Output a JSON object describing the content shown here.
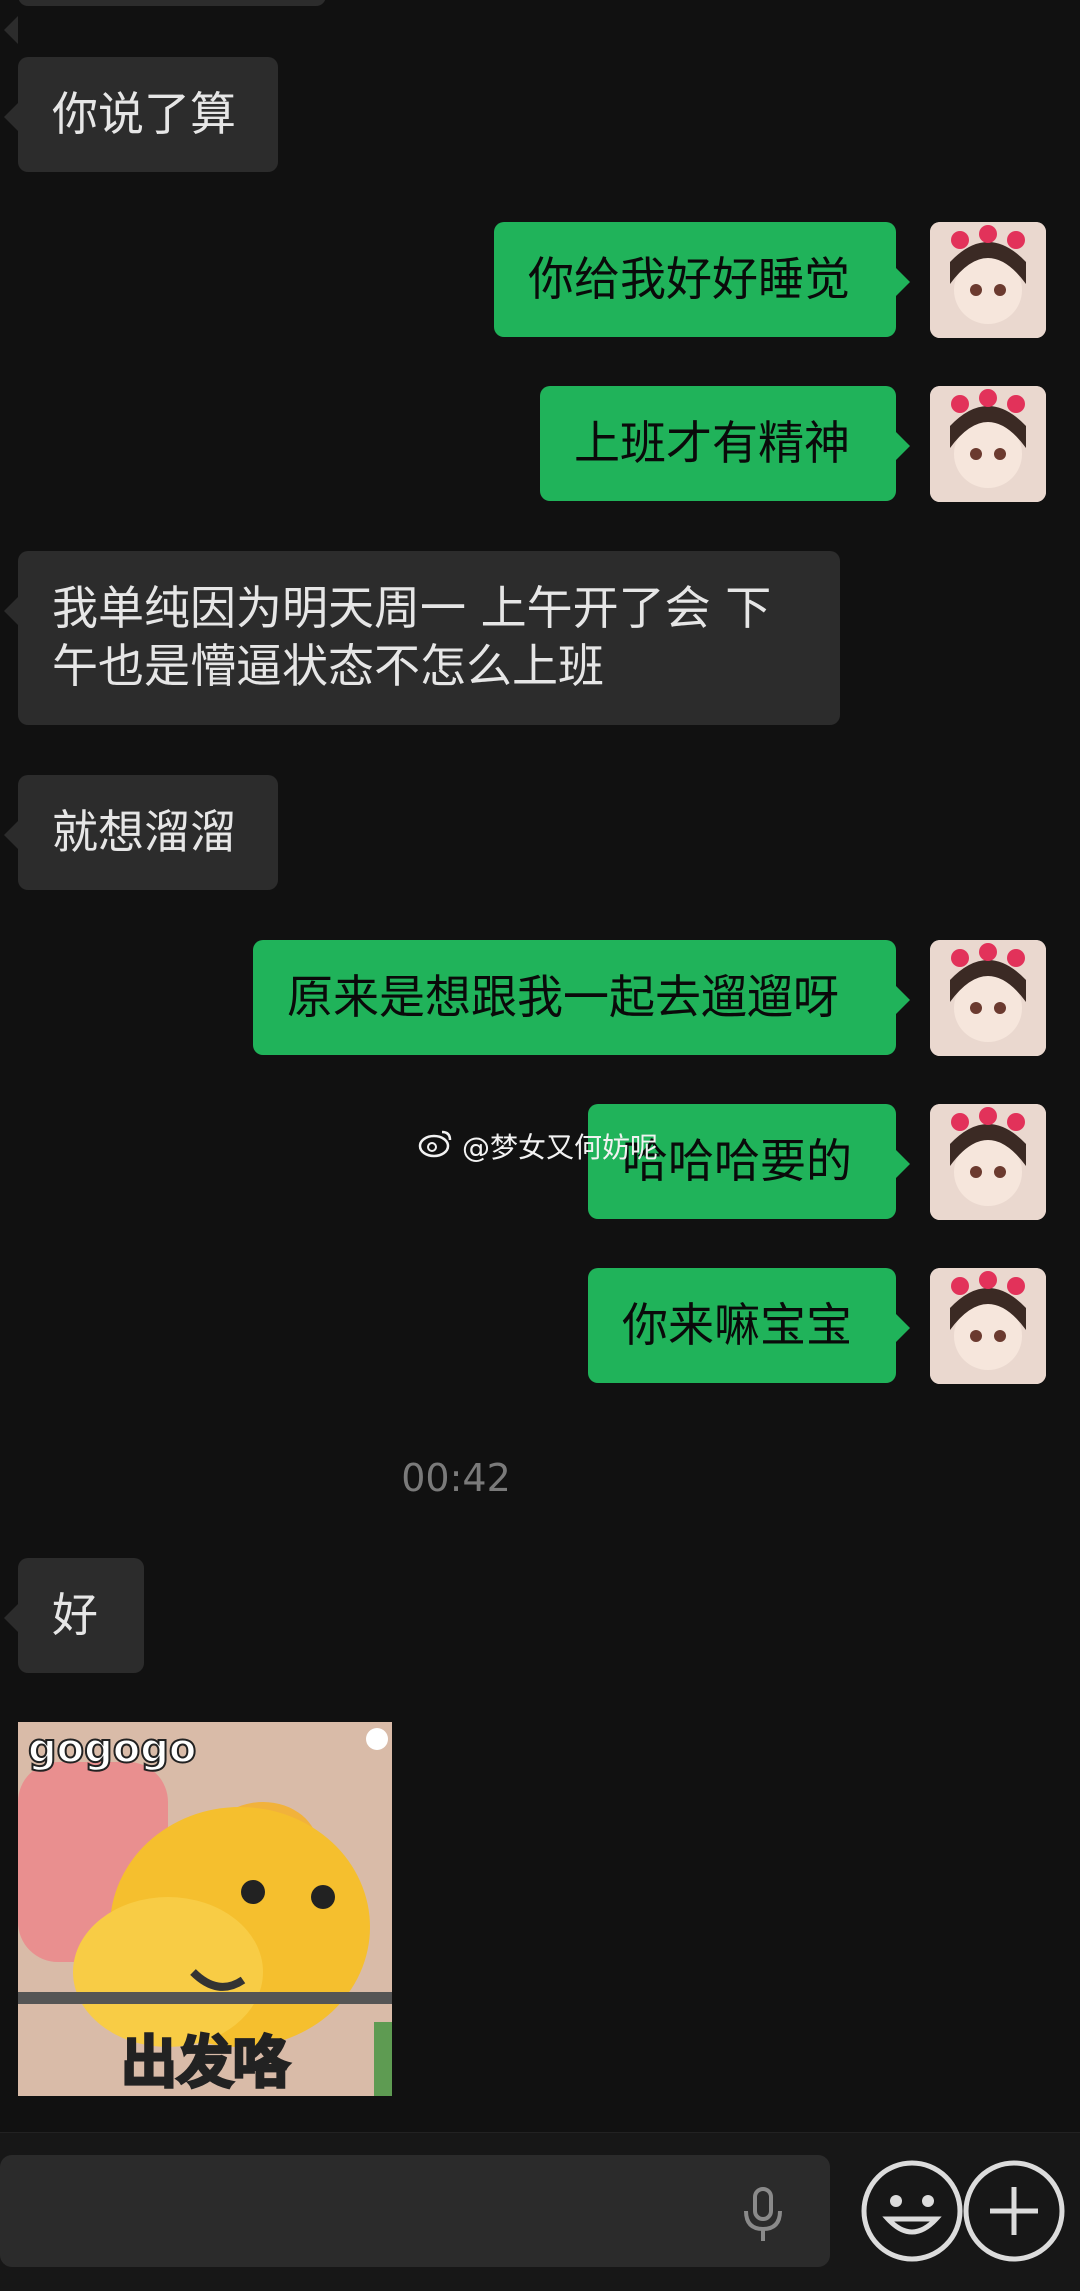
{
  "chat": {
    "messages": [
      {
        "side": "in",
        "text": "你说了算"
      },
      {
        "side": "out",
        "text": "你给我好好睡觉"
      },
      {
        "side": "out",
        "text": "上班才有精神"
      },
      {
        "side": "in",
        "text": "我单纯因为明天周一 上午开了会  下午也是懵逼状态不怎么上班"
      },
      {
        "side": "in",
        "text": "就想溜溜"
      },
      {
        "side": "out",
        "text": "原来是想跟我一起去遛遛呀"
      },
      {
        "side": "out",
        "text": "哈哈哈要的"
      },
      {
        "side": "out",
        "text": "你来嘛宝宝"
      },
      {
        "side": "time",
        "text": "00:42"
      },
      {
        "side": "in",
        "text": "好"
      }
    ],
    "sticker": {
      "top_text": "gogogo",
      "bottom_text": "出发咯"
    },
    "watermark": "@梦女又何妨呢"
  },
  "icons": {
    "voice": "microphone-icon",
    "emoji": "emoji-icon",
    "more": "plus-icon",
    "weibo": "weibo-icon"
  },
  "colors": {
    "background": "#111111",
    "incoming_bubble": "#2c2c2c",
    "outgoing_bubble": "#20b35a"
  }
}
